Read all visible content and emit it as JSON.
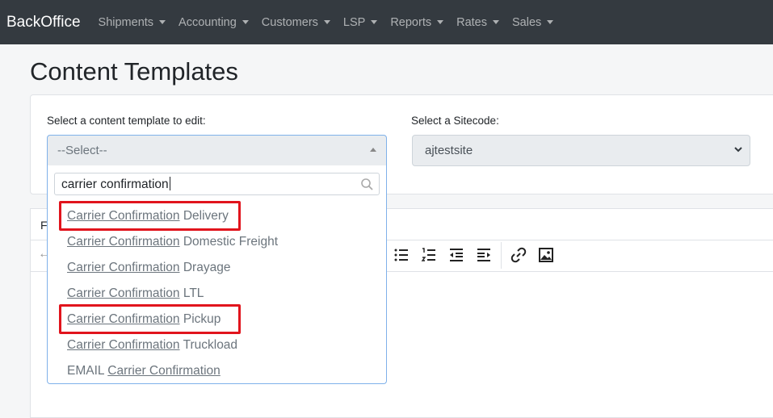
{
  "navbar": {
    "brand": "BackOffice",
    "items": [
      {
        "label": "Shipments"
      },
      {
        "label": "Accounting"
      },
      {
        "label": "Customers"
      },
      {
        "label": "LSP"
      },
      {
        "label": "Reports"
      },
      {
        "label": "Rates"
      },
      {
        "label": "Sales"
      }
    ]
  },
  "page": {
    "title": "Content Templates"
  },
  "form": {
    "template_label": "Select a content template to edit:",
    "template_value": "--Select--",
    "sitecode_label": "Select a Sitecode:",
    "sitecode_value": "ajtestsite"
  },
  "editor": {
    "tab_label": "F"
  },
  "dropdown": {
    "search_value": "carrier confirmation",
    "options": [
      {
        "match": "Carrier Confirmation",
        "rest": " Delivery",
        "highlighted": true
      },
      {
        "match": "Carrier Confirmation",
        "rest": " Domestic Freight",
        "highlighted": false
      },
      {
        "match": "Carrier Confirmation",
        "rest": " Drayage",
        "highlighted": false
      },
      {
        "match": "Carrier Confirmation",
        "rest": " LTL",
        "highlighted": false
      },
      {
        "match": "Carrier Confirmation",
        "rest": " Pickup",
        "highlighted": true
      },
      {
        "match": "Carrier Confirmation",
        "rest": " Truckload",
        "highlighted": false
      },
      {
        "prefix": "EMAIL ",
        "match": "Carrier Confirmation",
        "highlighted": false
      }
    ]
  },
  "colors": {
    "navbar": "#343a40",
    "highlight": "#e1141d",
    "focus_border": "#7fb1ea"
  }
}
